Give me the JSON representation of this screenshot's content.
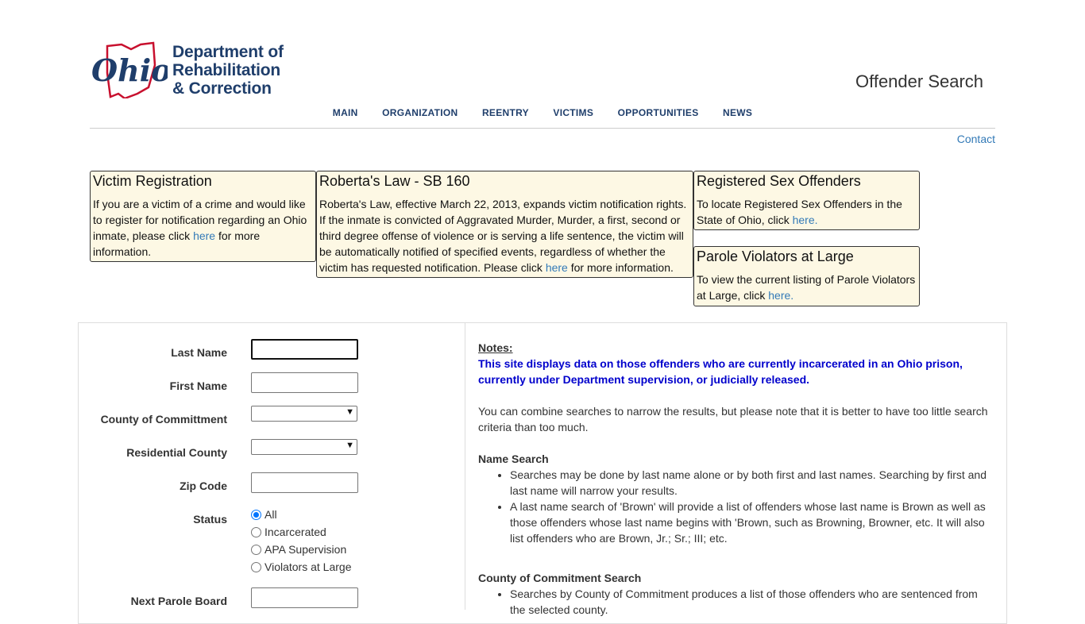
{
  "header": {
    "logo_lines": [
      "Department of",
      "Rehabilitation",
      "& Correction"
    ],
    "logo_mark_text": "Ohio",
    "site_title": "Offender Search",
    "nav": [
      "MAIN",
      "ORGANIZATION",
      "REENTRY",
      "VICTIMS",
      "OPPORTUNITIES",
      "NEWS"
    ],
    "contact": "Contact"
  },
  "boxes": {
    "victim": {
      "title": "Victim Registration",
      "text_before": "If you are a victim of a crime and would like to register for notification regarding an Ohio inmate, please click ",
      "link": "here",
      "text_after": " for more information."
    },
    "roberta": {
      "title": "Roberta's Law - SB 160",
      "text_before": "Roberta's Law, effective March 22, 2013, expands victim notification rights. If the inmate is convicted of Aggravated Murder, Murder, a first, second or third degree offense of violence or is serving a life sentence, the victim will be automatically notified of specified events, regardless of whether the victim has requested notification. Please click ",
      "link": "here",
      "text_after": " for more information."
    },
    "sex_offenders": {
      "title": "Registered Sex Offenders",
      "text_before": "To locate Registered Sex Offenders in the State of Ohio, click ",
      "link": "here."
    },
    "parole": {
      "title": "Parole Violators at Large",
      "text_before": "To view the current listing of Parole Violators at Large, click ",
      "link": "here."
    }
  },
  "form": {
    "last_name": "Last Name",
    "first_name": "First Name",
    "county_commitment": "County of Committment",
    "residential_county": "Residential County",
    "zip_code": "Zip Code",
    "status": "Status",
    "status_options": [
      "All",
      "Incarcerated",
      "APA Supervision",
      "Violators at Large"
    ],
    "next_parole": "Next Parole Board"
  },
  "notes": {
    "heading": "Notes:",
    "highlight": "This site displays data on those offenders who are currently incarcerated in an Ohio prison, currently under Department supervision, or judicially released.",
    "intro": "You can combine searches to narrow the results, but please note that it is better to have too little search criteria than too much.",
    "name_search_title": "Name Search",
    "name_search_items": [
      "Searches may be done by last name alone or by both first and last names. Searching by first and last name will narrow your results.",
      "A last name search of 'Brown' will provide a list of offenders whose last name is Brown as well as those offenders whose last name begins with 'Brown, such as Browning, Browner, etc. It will also list offenders who are Brown, Jr.; Sr.; III; etc."
    ],
    "county_search_title": "County of Commitment Search",
    "county_search_items": [
      "Searches by County of Commitment produces a list of those offenders who are sentenced from the selected county."
    ]
  },
  "colors": {
    "brand_navy": "#1f3e6b",
    "brand_red": "#c8102e",
    "box_bg": "#fdf8e4",
    "link": "#337ab7",
    "notice_blue": "#0000cc"
  }
}
